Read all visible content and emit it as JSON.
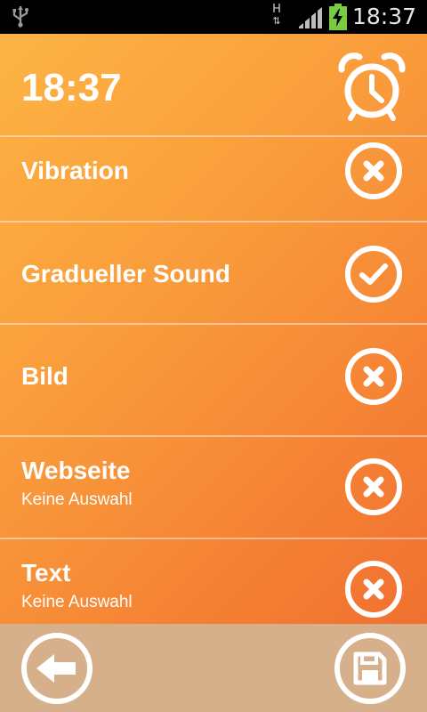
{
  "status_bar": {
    "time": "18:37",
    "network_type": "H",
    "icons": [
      "usb-icon",
      "network-type-icon",
      "signal-icon",
      "battery-charging-icon"
    ],
    "battery_color": "#7ac943"
  },
  "header": {
    "time": "18:37",
    "icon": "alarm-clock-icon"
  },
  "settings": [
    {
      "label": "Vibration",
      "subtitle": "",
      "enabled": false
    },
    {
      "label": "Gradueller Sound",
      "subtitle": "",
      "enabled": true
    },
    {
      "label": "Bild",
      "subtitle": "",
      "enabled": false
    },
    {
      "label": "Webseite",
      "subtitle": "Keine Auswahl",
      "enabled": false
    },
    {
      "label": "Text",
      "subtitle": "Keine Auswahl",
      "enabled": false
    }
  ],
  "bottom_bar": {
    "back_icon": "arrow-left-icon",
    "save_icon": "save-icon"
  },
  "colors": {
    "gradient_start": "#fdb444",
    "gradient_end": "#ef6a2e",
    "bottom_bar": "#d6b08b",
    "icon": "#ffffff"
  }
}
